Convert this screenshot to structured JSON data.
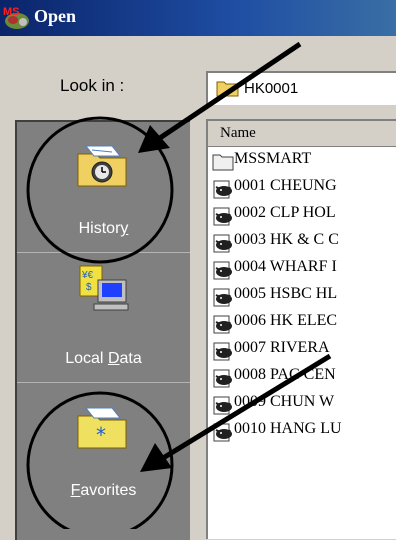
{
  "window": {
    "title": "Open",
    "logo": "MS"
  },
  "lookin": {
    "label": "Look in :",
    "value": "HK0001",
    "icon": "folder-icon"
  },
  "places": [
    {
      "id": "history",
      "label_pre": "Histor",
      "label_ul": "y",
      "label_post": "",
      "icon": "history-icon"
    },
    {
      "id": "local-data",
      "label_pre": "Local ",
      "label_ul": "D",
      "label_post": "ata",
      "icon": "local-data-icon"
    },
    {
      "id": "favorites",
      "label_pre": "",
      "label_ul": "F",
      "label_post": "avorites",
      "icon": "favorites-icon"
    }
  ],
  "filelist": {
    "column_header": "Name",
    "items": [
      {
        "name": "MSSMART",
        "icon": "folder-icon"
      },
      {
        "name": "0001 CHEUNG",
        "icon": "bull-stock-icon"
      },
      {
        "name": "0002 CLP HOL",
        "icon": "bull-stock-icon"
      },
      {
        "name": "0003 HK & C C",
        "icon": "bull-stock-icon"
      },
      {
        "name": "0004 WHARF I",
        "icon": "bull-stock-icon"
      },
      {
        "name": "0005 HSBC HL",
        "icon": "bull-stock-icon"
      },
      {
        "name": "0006 HK ELEC",
        "icon": "bull-stock-icon"
      },
      {
        "name": "0007 RIVERA",
        "icon": "bull-stock-icon"
      },
      {
        "name": "0008 PAC CEN",
        "icon": "bull-stock-icon"
      },
      {
        "name": "0009 CHUN W",
        "icon": "bull-stock-icon"
      },
      {
        "name": "0010 HANG LU",
        "icon": "bull-stock-icon"
      }
    ]
  },
  "colors": {
    "titlebar": "#0a246a",
    "face": "#d4d0c8",
    "places_bg": "#808080",
    "folder": "#f0d060"
  }
}
